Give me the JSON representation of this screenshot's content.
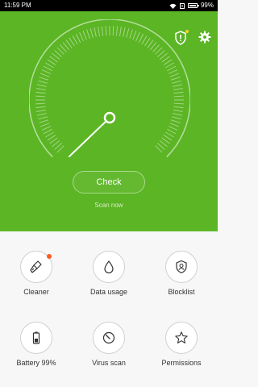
{
  "status": {
    "time": "11:59 PM",
    "sim": "x",
    "battery": "99%"
  },
  "hero": {
    "check_label": "Check",
    "scan_now": "Scan now",
    "colors": {
      "background": "#5bb524",
      "badge": "#ffd028"
    }
  },
  "tools": [
    {
      "label": "Cleaner",
      "icon": "broom-icon",
      "has_badge": true
    },
    {
      "label": "Data usage",
      "icon": "drop-icon",
      "has_badge": false
    },
    {
      "label": "Blocklist",
      "icon": "shield-user-icon",
      "has_badge": false
    },
    {
      "label": "Battery 99%",
      "icon": "battery-icon",
      "has_badge": false
    },
    {
      "label": "Virus scan",
      "icon": "scan-dial-icon",
      "has_badge": false
    },
    {
      "label": "Permissions",
      "icon": "star-icon",
      "has_badge": false
    }
  ]
}
